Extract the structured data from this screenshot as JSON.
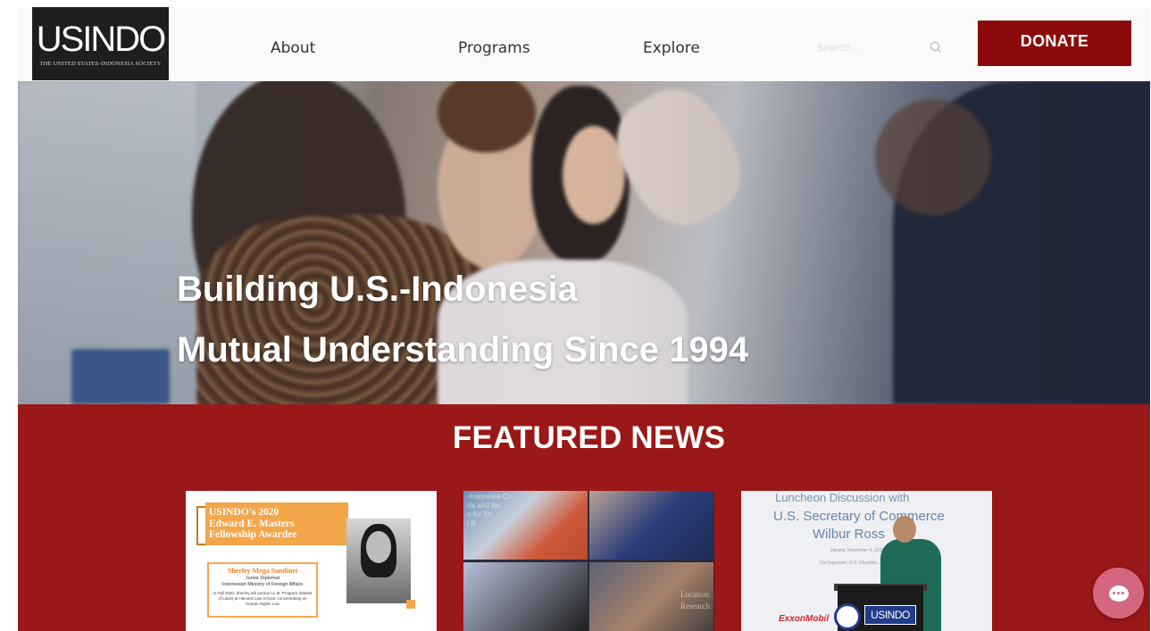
{
  "header": {
    "logo": {
      "wordmark": "USINDO",
      "tagline": "THE UNITED STATES-INDONESIA SOCIETY"
    },
    "nav": [
      {
        "label": "About"
      },
      {
        "label": "Programs"
      },
      {
        "label": "Explore"
      }
    ],
    "search": {
      "placeholder": "Search...",
      "icon": "search-icon"
    },
    "donate_label": "DONATE"
  },
  "hero": {
    "line1": "Building U.S.-Indonesia",
    "line2": "Mutual Understanding Since 1994"
  },
  "featured": {
    "title": "FEATURED NEWS",
    "card1": {
      "heading_line1": "USINDO's 2020",
      "heading_line2": "Edward E. Masters",
      "heading_line3": "Fellowship Awardee",
      "name": "Sherley Mega Sandiori",
      "role_line1": "Junior Diplomat",
      "role_line2": "Indonesian Ministry of Foreign Affairs",
      "note": "In Fall 2020, Sherley will pursue LL.M. Program (Master of Laws) at Harvard Law School, concentrating on Human Rights Law"
    },
    "card2": {
      "overlay_text": "-Indonesia Co\nrta and Ne\nn for Th\nt B",
      "tile4_text": "Location\nResearch"
    },
    "card3": {
      "line1": "Luncheon Discussion with",
      "line2": "U.S. Secretary of Commerce",
      "line3": "Wilbur Ross",
      "small1": "Jakarta, November 6, 2019",
      "small2": "Co-Organizer: U.S. Chamber...",
      "sponsor": "ExxonMobil",
      "podium_logo": "USINDO"
    }
  },
  "chat": {
    "icon": "chat-icon"
  },
  "colors": {
    "donate": "#8b0b0b",
    "featured_bg": "#9b1818",
    "chat": "#d4677f"
  }
}
